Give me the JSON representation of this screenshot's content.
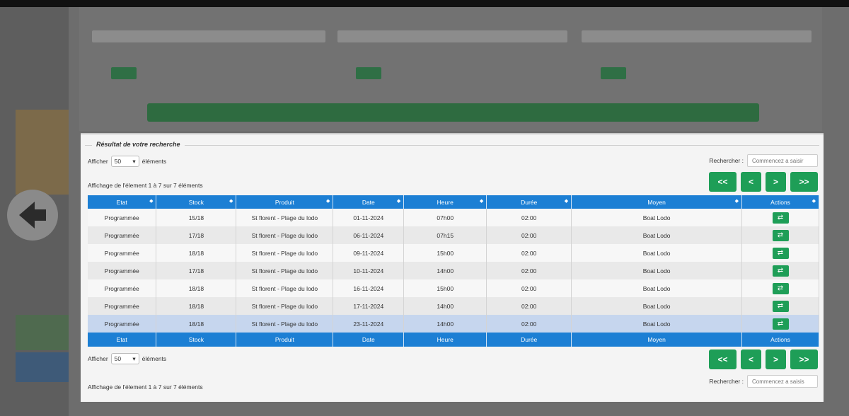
{
  "results": {
    "title": "Résultat de votre recherche",
    "length_label_before": "Afficher",
    "length_value": "50",
    "length_label_after": "éléments",
    "search_label": "Rechercher :",
    "search_placeholder": "Commencez a saisir",
    "search_placeholder_bottom": "Commencez a saisis",
    "info_text": "Affichage de l'élement 1 à 7 sur 7 éléments",
    "pager": {
      "first": "<<",
      "prev": "<",
      "next": ">",
      "last": ">>"
    },
    "columns": [
      "Etat",
      "Stock",
      "Produit",
      "Date",
      "Heure",
      "Durée",
      "Moyen",
      "Actions"
    ],
    "rows": [
      {
        "etat": "Programmée",
        "stock": "15/18",
        "produit": "St florent - Plage du lodo",
        "date": "01-11-2024",
        "heure": "07h00",
        "duree": "02:00",
        "moyen": "Boat Lodo"
      },
      {
        "etat": "Programmée",
        "stock": "17/18",
        "produit": "St florent - Plage du lodo",
        "date": "06-11-2024",
        "heure": "07h15",
        "duree": "02:00",
        "moyen": "Boat Lodo"
      },
      {
        "etat": "Programmée",
        "stock": "18/18",
        "produit": "St florent - Plage du lodo",
        "date": "09-11-2024",
        "heure": "15h00",
        "duree": "02:00",
        "moyen": "Boat Lodo"
      },
      {
        "etat": "Programmée",
        "stock": "17/18",
        "produit": "St florent - Plage du lodo",
        "date": "10-11-2024",
        "heure": "14h00",
        "duree": "02:00",
        "moyen": "Boat Lodo"
      },
      {
        "etat": "Programmée",
        "stock": "18/18",
        "produit": "St florent - Plage du lodo",
        "date": "16-11-2024",
        "heure": "15h00",
        "duree": "02:00",
        "moyen": "Boat Lodo"
      },
      {
        "etat": "Programmée",
        "stock": "18/18",
        "produit": "St florent - Plage du lodo",
        "date": "17-11-2024",
        "heure": "14h00",
        "duree": "02:00",
        "moyen": "Boat Lodo"
      },
      {
        "etat": "Programmée",
        "stock": "18/18",
        "produit": "St florent - Plage du lodo",
        "date": "23-11-2024",
        "heure": "14h00",
        "duree": "02:00",
        "moyen": "Boat Lodo"
      }
    ],
    "action_icon": "transfer-icon",
    "selected_row_index": 6
  },
  "colors": {
    "header_blue": "#1c7fd4",
    "green": "#1e9e57",
    "selected_row": "#c6d6ee"
  }
}
